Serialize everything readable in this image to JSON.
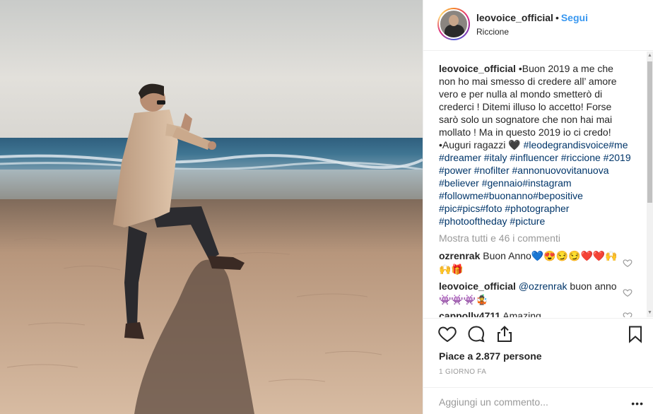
{
  "post": {
    "username": "leovoice_official",
    "separator": "•",
    "follow_label": "Segui",
    "location": "Riccione"
  },
  "caption": {
    "username": "leovoice_official",
    "text": "•Buon 2019 a me che non ho mai smesso di credere all’ amore vero e per nulla al mondo smetterò di crederci ! Ditemi illuso lo accetto! Forse sarò solo un sognatore che non hai mai mollato ! Ma in questo 2019 io ci credo!•Auguri ragazzi 🖤",
    "hashtags": "#leodegrandisvoice#me #dreamer #italy #influencer #riccione #2019 #power #nofilter #annonuovovitanuova #believer #gennaio#instagram #followme#buonanno#bepositive #pic#pics#foto #photographer #photooftheday #picture"
  },
  "view_all_comments": "Mostra tutti e 46 i commenti",
  "comments": [
    {
      "username": "ozrenrak",
      "text": "Buon Anno💙😍😏😏❤️❤️🙌🙌🎁",
      "mention": ""
    },
    {
      "username": "leovoice_official",
      "mention": "@ozrenrak",
      "text": " buon anno 👾👾👾🤹"
    },
    {
      "username": "cappolly4711",
      "text": "Amazing",
      "mention": ""
    }
  ],
  "likes_text": "Piace a 2.877 persone",
  "timestamp": "1 GIORNO FA",
  "comment_input": {
    "placeholder": "Aggiungi un commento..."
  },
  "icons": {
    "like": "heart-icon",
    "comment": "comment-icon",
    "share": "share-icon",
    "save": "bookmark-icon",
    "more": "more-options-icon"
  },
  "colors": {
    "follow_blue": "#3897f0",
    "hashtag": "#003569",
    "muted": "#999999"
  }
}
